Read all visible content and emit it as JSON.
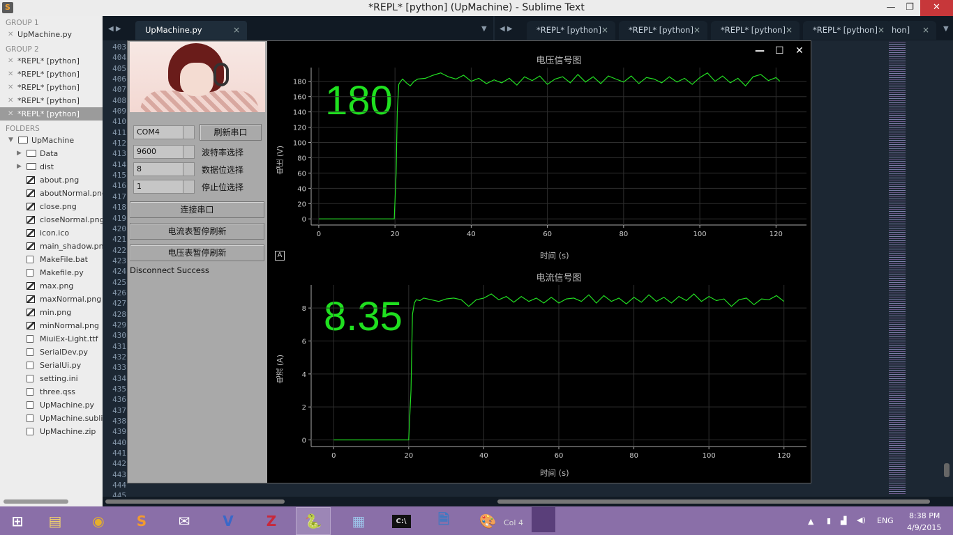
{
  "window": {
    "title": "*REPL* [python] (UpMachine) - Sublime Text",
    "minimize": "—",
    "maximize": "❐",
    "close": "✕"
  },
  "sidebar": {
    "group1": "GROUP 1",
    "group1_files": [
      "UpMachine.py"
    ],
    "group2": "GROUP 2",
    "group2_files": [
      "*REPL* [python]",
      "*REPL* [python]",
      "*REPL* [python]",
      "*REPL* [python]",
      "*REPL* [python]"
    ],
    "folders_label": "FOLDERS",
    "root": "UpMachine",
    "dirs": [
      "Data",
      "dist"
    ],
    "files": [
      {
        "name": "about.png",
        "icon": "image-file-icon"
      },
      {
        "name": "aboutNormal.png",
        "icon": "image-file-icon"
      },
      {
        "name": "close.png",
        "icon": "image-file-icon"
      },
      {
        "name": "closeNormal.png",
        "icon": "image-file-icon"
      },
      {
        "name": "icon.ico",
        "icon": "image-file-icon"
      },
      {
        "name": "main_shadow.pn",
        "icon": "image-file-icon"
      },
      {
        "name": "MakeFile.bat",
        "icon": "text-file-icon"
      },
      {
        "name": "Makefile.py",
        "icon": "text-file-icon"
      },
      {
        "name": "max.png",
        "icon": "image-file-icon"
      },
      {
        "name": "maxNormal.png",
        "icon": "image-file-icon"
      },
      {
        "name": "min.png",
        "icon": "image-file-icon"
      },
      {
        "name": "minNormal.png",
        "icon": "image-file-icon"
      },
      {
        "name": "MiuiEx-Light.ttf",
        "icon": "text-file-icon"
      },
      {
        "name": "SerialDev.py",
        "icon": "text-file-icon"
      },
      {
        "name": "SerialUi.py",
        "icon": "text-file-icon"
      },
      {
        "name": "setting.ini",
        "icon": "text-file-icon"
      },
      {
        "name": "three.qss",
        "icon": "text-file-icon"
      },
      {
        "name": "UpMachine.py",
        "icon": "text-file-icon"
      },
      {
        "name": "UpMachine.subli",
        "icon": "text-file-icon"
      },
      {
        "name": "UpMachine.zip",
        "icon": "text-file-icon"
      }
    ]
  },
  "tabs": {
    "left": [
      {
        "label": "UpMachine.py",
        "close": "×"
      }
    ],
    "right": [
      {
        "label": "*REPL* [python]",
        "close": "×"
      },
      {
        "label": "*REPL* [python]",
        "close": "×"
      },
      {
        "label": "*REPL* [python]",
        "close": "×"
      },
      {
        "label": "*REPL* [python]",
        "close": "×"
      },
      {
        "label": "hon]",
        "close": "×"
      }
    ]
  },
  "gutter": {
    "line_numbers": [
      "403",
      "404",
      "405",
      "406",
      "407",
      "408",
      "409",
      "410",
      "411",
      "412",
      "413",
      "414",
      "415",
      "416",
      "417",
      "418",
      "419",
      "420",
      "421",
      "422",
      "423",
      "424",
      "425",
      "426",
      "427",
      "428",
      "429",
      "430",
      "431",
      "432",
      "433",
      "434",
      "435",
      "436",
      "437",
      "438",
      "439",
      "440",
      "441",
      "442",
      "443",
      "444",
      "445"
    ]
  },
  "panel": {
    "port": "COM4",
    "refresh_port": "刷新串口",
    "baud": "9600",
    "baud_label": "波特率选择",
    "databits": "8",
    "databits_label": "数据位选择",
    "stopbits": "1",
    "stopbits_label": "停止位选择",
    "connect": "连接串口",
    "pause_current": "电流表暂停刷新",
    "pause_voltage": "电压表暂停刷新",
    "status": "Disconnect Success"
  },
  "plot_window": {
    "min": "—",
    "max": "☐",
    "close": "✕",
    "auto_btn": "A"
  },
  "chart_data": [
    {
      "type": "line",
      "title": "电压信号图",
      "xlabel": "时间 (s)",
      "ylabel": "电压 (V)",
      "readout": "180",
      "xlim": [
        -2,
        128
      ],
      "ylim": [
        -8,
        198
      ],
      "xticks": [
        0,
        20,
        40,
        60,
        80,
        100,
        120
      ],
      "yticks": [
        0,
        20,
        40,
        60,
        80,
        100,
        120,
        140,
        160,
        180
      ],
      "grid": true,
      "color": "#22dd22",
      "series": [
        {
          "x": [
            0,
            19.8,
            20.3,
            20.6,
            21,
            21.5,
            22,
            23,
            24,
            25,
            26,
            28,
            30,
            32,
            34,
            36,
            38,
            40,
            42,
            44,
            46,
            48,
            50,
            52,
            54,
            56,
            58,
            60,
            62,
            64,
            66,
            68,
            70,
            72,
            74,
            76,
            78,
            80,
            82,
            84,
            86,
            88,
            90,
            92,
            94,
            96,
            98,
            100,
            102,
            104,
            106,
            108,
            110,
            112,
            114,
            116,
            118,
            120,
            121
          ],
          "y": [
            0,
            0,
            60,
            140,
            176,
            180,
            183,
            178,
            174,
            180,
            183,
            184,
            188,
            191,
            186,
            183,
            188,
            180,
            184,
            177,
            182,
            178,
            184,
            175,
            186,
            181,
            187,
            176,
            183,
            186,
            178,
            189,
            179,
            186,
            177,
            187,
            183,
            179,
            187,
            177,
            185,
            183,
            178,
            186,
            179,
            184,
            176,
            185,
            191,
            180,
            187,
            178,
            184,
            174,
            186,
            189,
            181,
            185,
            180
          ]
        }
      ]
    },
    {
      "type": "line",
      "title": "电流信号图",
      "xlabel": "时间 (s)",
      "ylabel": "电流 (A)",
      "readout": "8.35",
      "xlim": [
        -6,
        126
      ],
      "ylim": [
        -0.4,
        9.4
      ],
      "xticks": [
        0,
        20,
        40,
        60,
        80,
        100,
        120
      ],
      "yticks": [
        0,
        2,
        4,
        6,
        8
      ],
      "grid": true,
      "color": "#22dd22",
      "series": [
        {
          "x": [
            0,
            20,
            20.6,
            21,
            21.5,
            22,
            23,
            24,
            26,
            28,
            30,
            32,
            34,
            36,
            38,
            40,
            42,
            44,
            46,
            48,
            50,
            52,
            54,
            56,
            58,
            60,
            62,
            64,
            66,
            68,
            70,
            72,
            74,
            76,
            78,
            80,
            82,
            84,
            86,
            88,
            90,
            92,
            94,
            96,
            98,
            100,
            102,
            104,
            106,
            108,
            110,
            112,
            114,
            116,
            118,
            120
          ],
          "y": [
            0,
            0,
            3,
            7.6,
            8.3,
            8.5,
            8.45,
            8.6,
            8.5,
            8.4,
            8.55,
            8.6,
            8.5,
            8.1,
            8.5,
            8.6,
            8.85,
            8.5,
            8.7,
            8.35,
            8.7,
            8.4,
            8.6,
            8.3,
            8.65,
            8.3,
            8.55,
            8.6,
            8.4,
            8.8,
            8.3,
            8.75,
            8.4,
            8.6,
            8.25,
            8.65,
            8.35,
            8.8,
            8.4,
            8.65,
            8.3,
            8.7,
            8.45,
            8.85,
            8.4,
            8.7,
            8.45,
            8.55,
            8.1,
            8.5,
            8.6,
            8.2,
            8.55,
            8.5,
            8.75,
            8.4
          ]
        }
      ]
    }
  ],
  "taskbar": {
    "apps": [
      "windows-start-icon",
      "file-explorer-icon",
      "chrome-icon",
      "sublime-text-icon",
      "foxmail-icon",
      "virtualbox-icon",
      "filezilla-icon",
      "python-icon",
      "calculator-icon",
      "cmd-icon",
      "python-file-icon",
      "paint-icon"
    ],
    "col_text": "Col 4",
    "lang": "ENG",
    "time": "8:38 PM",
    "date": "4/9/2015"
  }
}
